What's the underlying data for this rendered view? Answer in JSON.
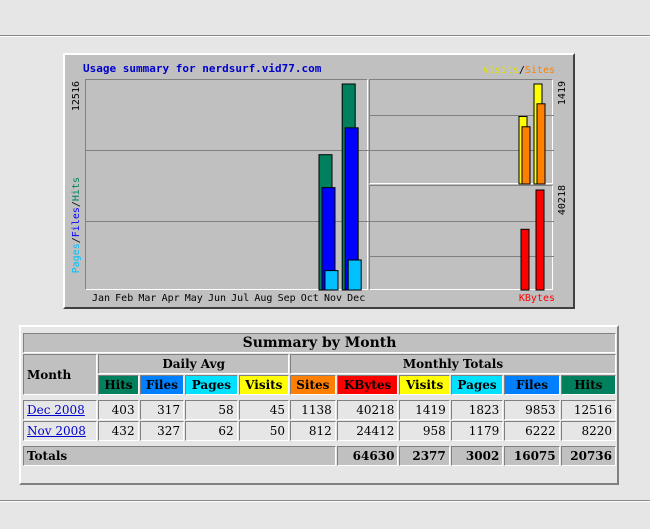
{
  "graph": {
    "title": "Usage summary for nerdsurf.vid77.com",
    "legend_visits": "Visits",
    "legend_sep": "/",
    "legend_sites": "Sites",
    "left_axis_max": "12516",
    "left_axis_labels": {
      "pages": "Pages",
      "files": "Files",
      "hits": "Hits",
      "sep": "/"
    },
    "right_top_max": "1419",
    "right_bottom_max": "40218",
    "kbytes_label": "KBytes",
    "months": [
      "Jan",
      "Feb",
      "Mar",
      "Apr",
      "May",
      "Jun",
      "Jul",
      "Aug",
      "Sep",
      "Oct",
      "Nov",
      "Dec"
    ],
    "colors": {
      "hits": "#00805c",
      "files": "#0000ff",
      "pages": "#00c0ff",
      "visits": "#ffff00",
      "sites": "#ff8000",
      "kbytes": "#ff0000"
    }
  },
  "chart_data": {
    "type": "bar",
    "categories": [
      "Jan",
      "Feb",
      "Mar",
      "Apr",
      "May",
      "Jun",
      "Jul",
      "Aug",
      "Sep",
      "Oct",
      "Nov",
      "Dec"
    ],
    "series": [
      {
        "name": "Hits",
        "values": [
          0,
          0,
          0,
          0,
          0,
          0,
          0,
          0,
          0,
          0,
          8220,
          12516
        ]
      },
      {
        "name": "Files",
        "values": [
          0,
          0,
          0,
          0,
          0,
          0,
          0,
          0,
          0,
          0,
          6222,
          9853
        ]
      },
      {
        "name": "Pages",
        "values": [
          0,
          0,
          0,
          0,
          0,
          0,
          0,
          0,
          0,
          0,
          1179,
          1823
        ]
      },
      {
        "name": "Visits",
        "values": [
          0,
          0,
          0,
          0,
          0,
          0,
          0,
          0,
          0,
          0,
          958,
          1419
        ]
      },
      {
        "name": "Sites",
        "values": [
          0,
          0,
          0,
          0,
          0,
          0,
          0,
          0,
          0,
          0,
          812,
          1138
        ]
      },
      {
        "name": "KBytes",
        "values": [
          0,
          0,
          0,
          0,
          0,
          0,
          0,
          0,
          0,
          0,
          24412,
          40218
        ]
      }
    ],
    "title": "Usage summary for nerdsurf.vid77.com"
  },
  "summary": {
    "title": "Summary by Month",
    "month_header": "Month",
    "daily_avg_header": "Daily Avg",
    "monthly_totals_header": "Monthly Totals",
    "daily_cols": [
      {
        "label": "Hits",
        "color": "#00805c"
      },
      {
        "label": "Files",
        "color": "#0080ff"
      },
      {
        "label": "Pages",
        "color": "#00e0ff"
      },
      {
        "label": "Visits",
        "color": "#ffff00"
      }
    ],
    "total_cols": [
      {
        "label": "Sites",
        "color": "#ff8000"
      },
      {
        "label": "KBytes",
        "color": "#ff0000"
      },
      {
        "label": "Visits",
        "color": "#ffff00"
      },
      {
        "label": "Pages",
        "color": "#00e0ff"
      },
      {
        "label": "Files",
        "color": "#0080ff"
      },
      {
        "label": "Hits",
        "color": "#00805c"
      }
    ],
    "rows": [
      {
        "month": "Dec 2008",
        "values": [
          "403",
          "317",
          "58",
          "45",
          "1138",
          "40218",
          "1419",
          "1823",
          "9853",
          "12516"
        ]
      },
      {
        "month": "Nov 2008",
        "values": [
          "432",
          "327",
          "62",
          "50",
          "812",
          "24412",
          "958",
          "1179",
          "6222",
          "8220"
        ]
      }
    ],
    "totals_label": "Totals",
    "totals": [
      "64630",
      "2377",
      "3002",
      "16075",
      "20736"
    ]
  }
}
